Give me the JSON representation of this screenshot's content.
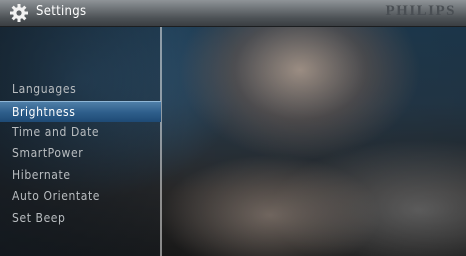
{
  "header": {
    "title": "Settings",
    "brand": "PHILIPS",
    "icon": "gear-icon"
  },
  "menu": {
    "items": [
      {
        "label": "Languages"
      },
      {
        "label": "Brightness"
      },
      {
        "label": "Time and Date"
      },
      {
        "label": "SmartPower"
      },
      {
        "label": "Hibernate"
      },
      {
        "label": "Auto Orientate"
      },
      {
        "label": "Set Beep"
      }
    ],
    "selected_label": "Brightness"
  },
  "colors": {
    "selection": "#2f5f8c",
    "titlebar": "#6d7276",
    "menu_text": "#b9bdc0"
  }
}
